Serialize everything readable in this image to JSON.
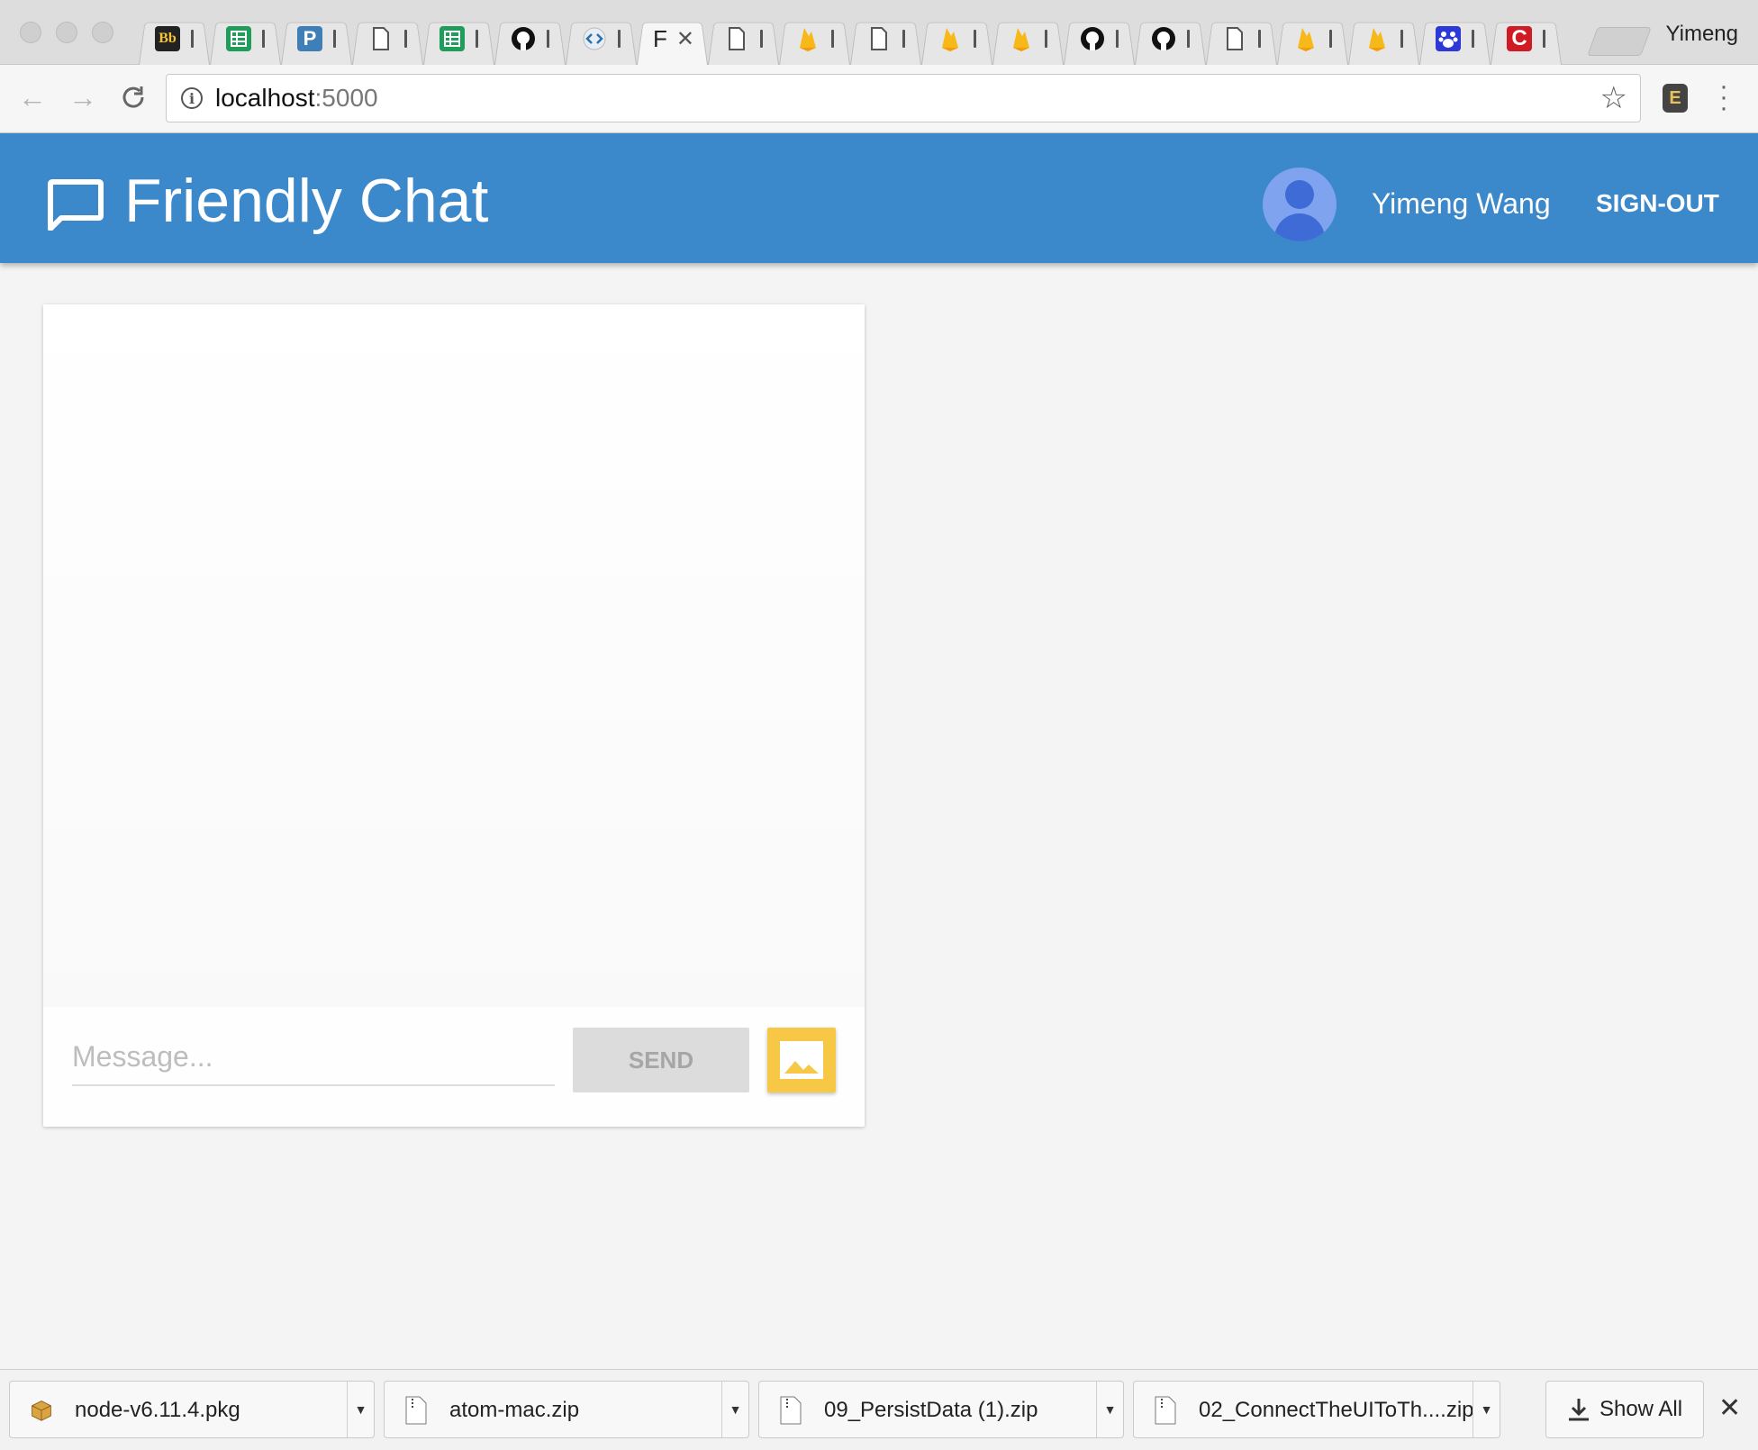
{
  "browser": {
    "profile_name": "Yimeng",
    "active_tab_label": "F",
    "tabs": [
      {
        "icon": "blackboard-icon",
        "glyph": "Bb"
      },
      {
        "icon": "sheets-icon"
      },
      {
        "icon": "p-app-icon",
        "glyph": "P"
      },
      {
        "icon": "document-icon"
      },
      {
        "icon": "sheets-icon"
      },
      {
        "icon": "github-icon"
      },
      {
        "icon": "code-icon"
      },
      {
        "icon": "active-tab"
      },
      {
        "icon": "document-icon"
      },
      {
        "icon": "firebase-icon"
      },
      {
        "icon": "document-icon"
      },
      {
        "icon": "firebase-icon"
      },
      {
        "icon": "firebase-icon"
      },
      {
        "icon": "github-icon"
      },
      {
        "icon": "github-icon"
      },
      {
        "icon": "document-icon"
      },
      {
        "icon": "firebase-icon"
      },
      {
        "icon": "firebase-icon"
      },
      {
        "icon": "baidu-paw-icon"
      },
      {
        "icon": "c-red-icon",
        "glyph": "C"
      }
    ],
    "url_host": "localhost",
    "url_port": ":5000"
  },
  "app": {
    "title": "Friendly Chat",
    "user_name": "Yimeng Wang",
    "sign_out_label": "SIGN-OUT",
    "accent_color": "#3b88cb"
  },
  "composer": {
    "placeholder": "Message...",
    "value": "",
    "send_label": "SEND",
    "image_button_color": "#f7c846"
  },
  "downloads": {
    "items": [
      {
        "name": "node-v6.11.4.pkg",
        "icon": "package-icon"
      },
      {
        "name": "atom-mac.zip",
        "icon": "zip-file-icon"
      },
      {
        "name": "09_PersistData (1).zip",
        "icon": "zip-file-icon"
      },
      {
        "name": "02_ConnectTheUIToTh....zip",
        "icon": "zip-file-icon"
      }
    ],
    "show_all_label": "Show All"
  }
}
